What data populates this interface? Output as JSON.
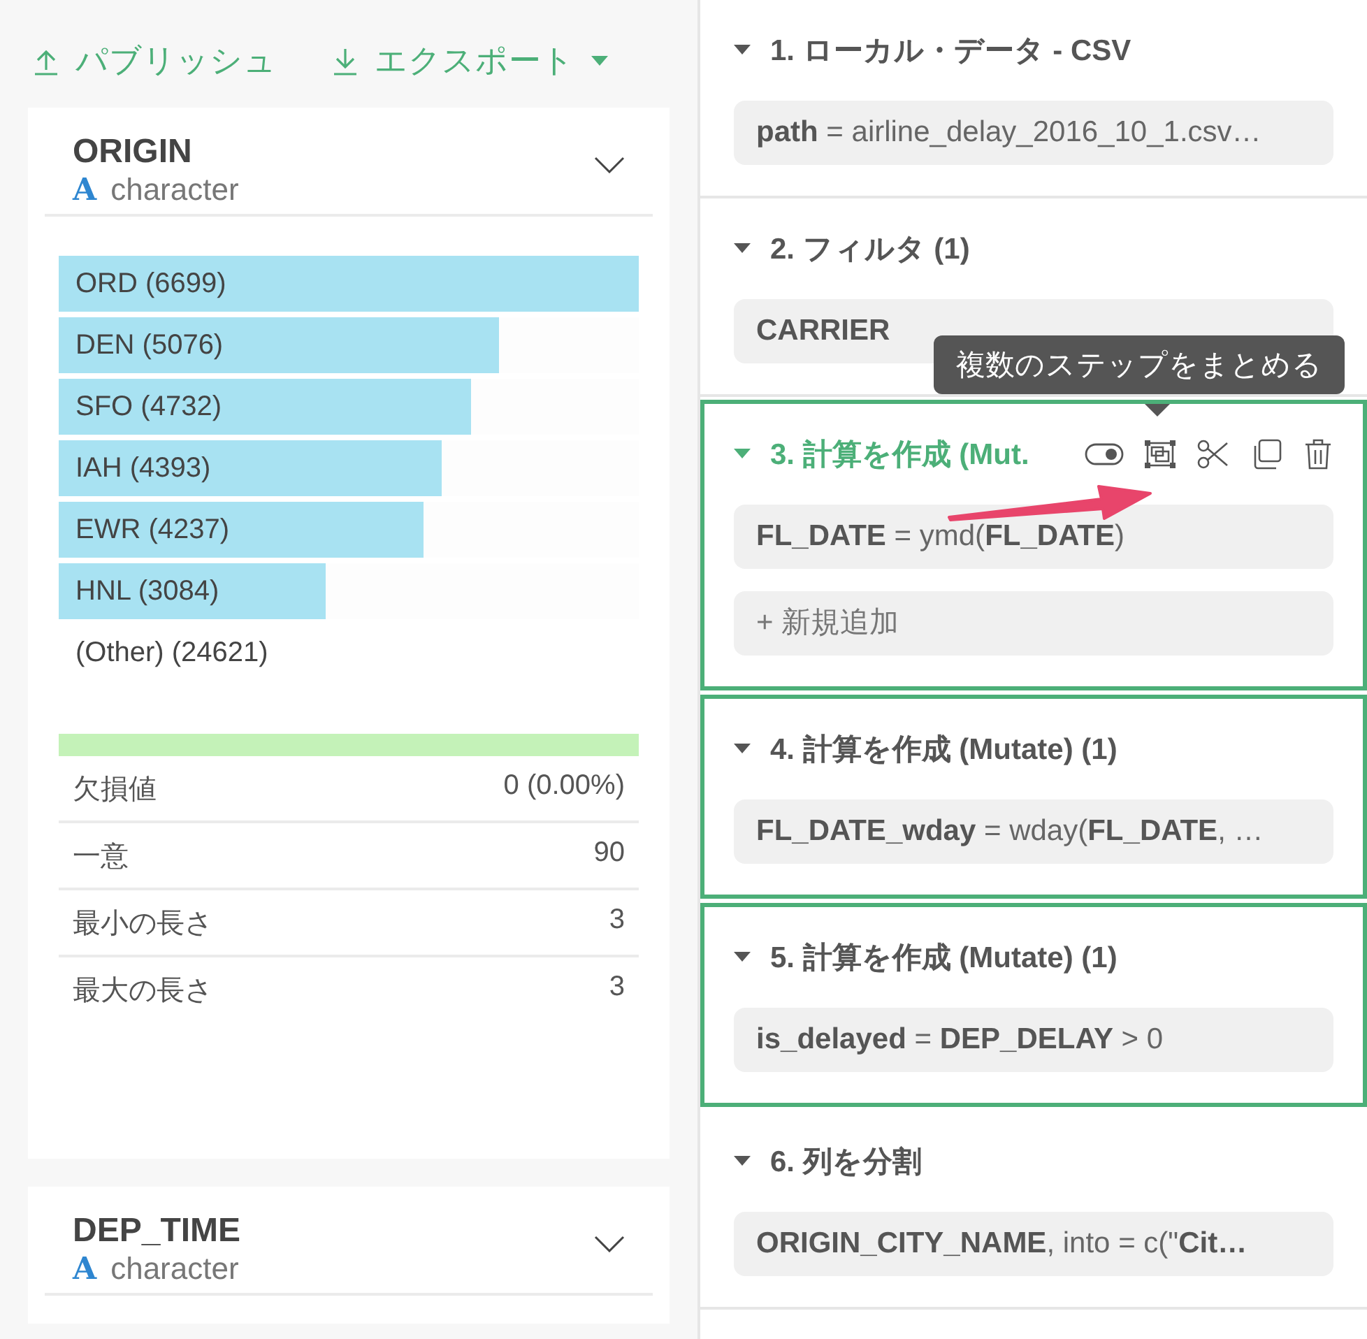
{
  "toolbar": [
    {
      "kind": "publish",
      "label": "パブリッシュ"
    },
    {
      "kind": "export",
      "label": "エクスポート"
    }
  ],
  "columns": [
    {
      "name": "ORIGIN",
      "type_icon": "A",
      "type": "character",
      "bars": [
        {
          "label": "ORD (6699)",
          "level": 1
        },
        {
          "label": "DEN (5076)",
          "level": 0.76
        },
        {
          "label": "SFO (4732)",
          "level": 0.71
        },
        {
          "label": "IAH (4393)",
          "level": 0.66
        },
        {
          "label": "EWR (4237)",
          "level": 0.63
        },
        {
          "label": "HNL (3084)",
          "level": 0.46
        },
        {
          "label": "(Other) (24621)"
        }
      ],
      "valid": {
        "level": 1
      },
      "stats": [
        {
          "label": "欠損値",
          "value": "0 (0.00%)"
        },
        {
          "label": "一意",
          "value": "90"
        },
        {
          "label": "最小の長さ",
          "value": "3"
        },
        {
          "label": "最大の長さ",
          "value": "3"
        }
      ]
    },
    {
      "name": "DEP_TIME",
      "type_icon": "A",
      "type": "character"
    }
  ],
  "steps": [
    {
      "title": "1. ローカル・データ - CSV",
      "selected": false,
      "current": false,
      "items": [
        "**path** = airline_delay_2016_10_1.csv…"
      ]
    },
    {
      "title": "2. フィルタ (1)",
      "selected": false,
      "current": false,
      "items": [
        "**CARRIER**"
      ]
    },
    {
      "title": "3. 計算を作成 (Mut.",
      "selected": true,
      "current": true,
      "items": [
        "**FL_DATE** = ymd(**FL_DATE**)"
      ],
      "add_label": "+ 新規追加"
    },
    {
      "title": "4. 計算を作成 (Mutate) (1)",
      "selected": true,
      "current": false,
      "items": [
        "**FL_DATE_wday** = wday(**FL_DATE**, …"
      ]
    },
    {
      "title": "5. 計算を作成 (Mutate) (1)",
      "selected": true,
      "current": false,
      "items": [
        "**is_delayed** = **DEP_DELAY** > 0"
      ]
    },
    {
      "title": "6. 列を分割",
      "selected": false,
      "current": false,
      "items": [
        "**ORIGIN_CITY_NAME**, into = c(\"**Cit…**"
      ]
    }
  ],
  "tooltip": "複数のステップをまとめる"
}
